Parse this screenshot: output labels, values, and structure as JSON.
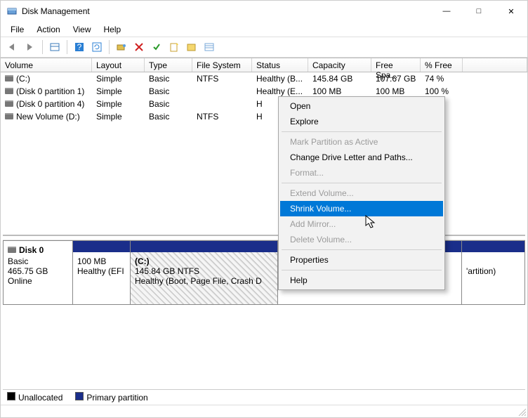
{
  "window": {
    "title": "Disk Management"
  },
  "menu": {
    "file": "File",
    "action": "Action",
    "view": "View",
    "help": "Help"
  },
  "columns": {
    "volume": "Volume",
    "layout": "Layout",
    "type": "Type",
    "fs": "File System",
    "status": "Status",
    "capacity": "Capacity",
    "free": "Free Spa...",
    "pct": "% Free"
  },
  "volumes": [
    {
      "name": "(C:)",
      "layout": "Simple",
      "type": "Basic",
      "fs": "NTFS",
      "status": "Healthy (B...",
      "capacity": "145.84 GB",
      "free": "107.67 GB",
      "pct": "74 %"
    },
    {
      "name": "(Disk 0 partition 1)",
      "layout": "Simple",
      "type": "Basic",
      "fs": "",
      "status": "Healthy (E...",
      "capacity": "100 MB",
      "free": "100 MB",
      "pct": "100 %"
    },
    {
      "name": "(Disk 0 partition 4)",
      "layout": "Simple",
      "type": "Basic",
      "fs": "",
      "status": "H",
      "capacity": "",
      "free": "",
      "pct": ""
    },
    {
      "name": "New Volume (D:)",
      "layout": "Simple",
      "type": "Basic",
      "fs": "NTFS",
      "status": "H",
      "capacity": "",
      "free": "",
      "pct": ""
    }
  ],
  "disk": {
    "label": "Disk 0",
    "type": "Basic",
    "size": "465.75 GB",
    "state": "Online",
    "parts": [
      {
        "line1": "",
        "line2": "100 MB",
        "line3": "Healthy (EFI"
      },
      {
        "line1": "(C:)",
        "line2": "145.84 GB NTFS",
        "line3": "Healthy (Boot, Page File, Crash D"
      },
      {
        "line1": "",
        "line2": "",
        "line3": ""
      },
      {
        "line1": "",
        "line2": "",
        "line3": "'artition)"
      }
    ]
  },
  "legend": {
    "unalloc": "Unallocated",
    "primary": "Primary partition"
  },
  "context_menu": {
    "open": "Open",
    "explore": "Explore",
    "mark_active": "Mark Partition as Active",
    "change_letter": "Change Drive Letter and Paths...",
    "format": "Format...",
    "extend": "Extend Volume...",
    "shrink": "Shrink Volume...",
    "add_mirror": "Add Mirror...",
    "delete": "Delete Volume...",
    "properties": "Properties",
    "help": "Help"
  }
}
